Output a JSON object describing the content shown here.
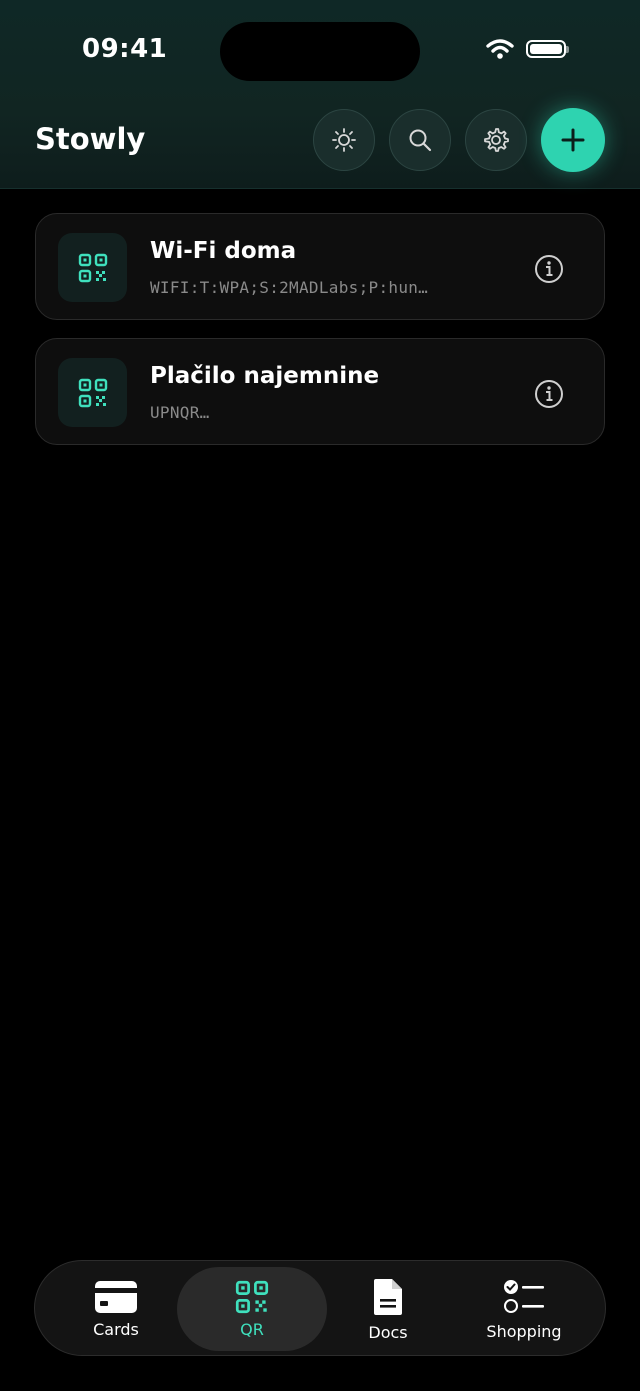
{
  "status_bar": {
    "time": "09:41"
  },
  "header": {
    "title": "Stowly",
    "accent_color": "#2ed3b0"
  },
  "items": [
    {
      "title": "Wi-Fi doma",
      "subtitle": "WIFI:T:WPA;S:2MADLabs;P:hun…"
    },
    {
      "title": "Plačilo najemnine",
      "subtitle": "UPNQR…"
    }
  ],
  "tabbar": {
    "active": "QR",
    "tabs": [
      {
        "label": "Cards",
        "icon": "card-icon"
      },
      {
        "label": "QR",
        "icon": "qr-icon"
      },
      {
        "label": "Docs",
        "icon": "document-icon"
      },
      {
        "label": "Shopping",
        "icon": "checklist-icon"
      }
    ]
  }
}
